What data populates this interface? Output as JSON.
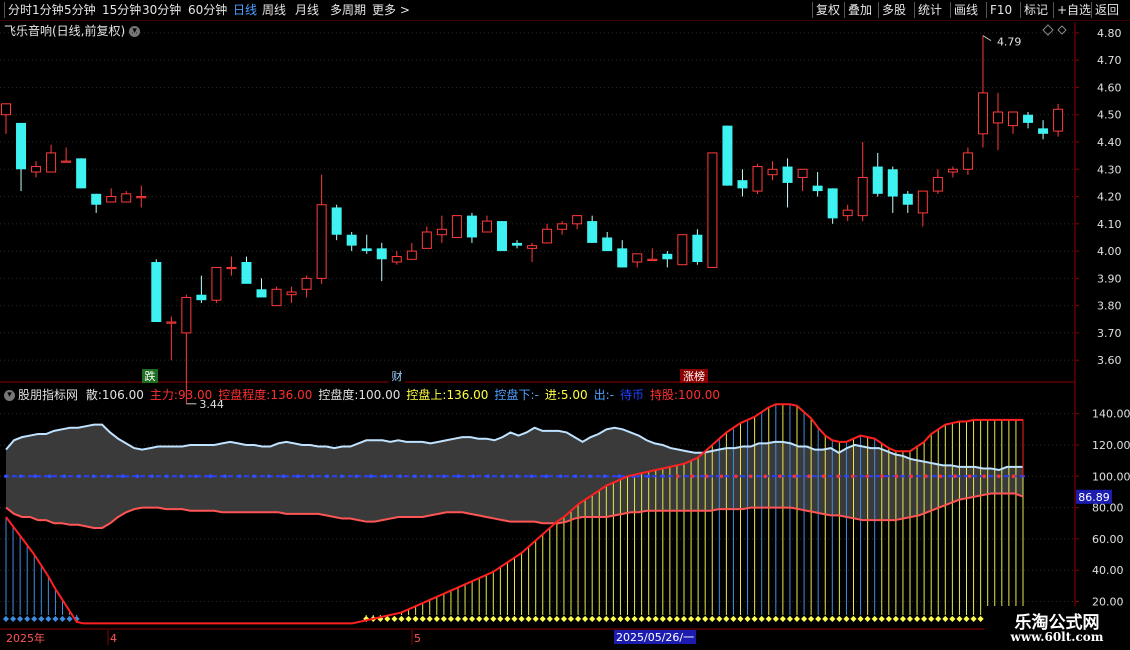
{
  "toolbar": {
    "left": [
      "分时",
      "1分钟",
      "5分钟",
      "15分钟",
      "30分钟",
      "60分钟",
      "日线",
      "周线",
      "月线",
      "多周期",
      "更多 >"
    ],
    "right": [
      "复权",
      "叠加",
      "多股",
      "统计",
      "画线",
      "F10",
      "标记",
      "+自选",
      "返回"
    ],
    "active_color": "#4ea0ff"
  },
  "main_chart": {
    "title": "飞乐音响(日线,前复权)",
    "high_label": "4.79",
    "low_label": "3.44",
    "y_ticks": [
      "4.80",
      "4.70",
      "4.60",
      "4.50",
      "4.40",
      "4.30",
      "4.20",
      "4.10",
      "4.00",
      "3.90",
      "3.80",
      "3.70",
      "3.60"
    ],
    "markers": [
      {
        "text": "跌",
        "bg": "#1f6e1f",
        "fg": "#ffffff"
      },
      {
        "text": "财",
        "bg": "#000000",
        "fg": "#9ad0ff"
      },
      {
        "text": "涨榜",
        "bg": "#8b0000",
        "fg": "#ffffff"
      }
    ]
  },
  "chart_data": {
    "type": "candlestick",
    "y_range": [
      3.52,
      4.84
    ],
    "candles": [
      [
        4.5,
        4.54,
        4.43,
        4.54
      ],
      [
        4.47,
        4.47,
        4.22,
        4.3
      ],
      [
        4.29,
        4.33,
        4.27,
        4.31
      ],
      [
        4.29,
        4.39,
        4.29,
        4.36
      ],
      [
        4.33,
        4.38,
        4.33,
        4.33
      ],
      [
        4.34,
        4.34,
        4.23,
        4.23
      ],
      [
        4.21,
        4.21,
        4.14,
        4.17
      ],
      [
        4.18,
        4.23,
        4.18,
        4.2
      ],
      [
        4.18,
        4.22,
        4.18,
        4.21
      ],
      [
        4.2,
        4.24,
        4.16,
        4.2
      ],
      [
        3.96,
        3.97,
        3.74,
        3.74
      ],
      [
        3.74,
        3.76,
        3.6,
        3.74
      ],
      [
        3.7,
        3.84,
        3.44,
        3.83
      ],
      [
        3.84,
        3.91,
        3.81,
        3.82
      ],
      [
        3.82,
        3.93,
        3.81,
        3.94
      ],
      [
        3.94,
        3.98,
        3.91,
        3.94
      ],
      [
        3.96,
        3.98,
        3.89,
        3.88
      ],
      [
        3.86,
        3.9,
        3.84,
        3.83
      ],
      [
        3.8,
        3.87,
        3.8,
        3.86
      ],
      [
        3.84,
        3.87,
        3.81,
        3.85
      ],
      [
        3.86,
        3.91,
        3.83,
        3.9
      ],
      [
        3.9,
        4.28,
        3.88,
        4.17
      ],
      [
        4.16,
        4.17,
        4.04,
        4.06
      ],
      [
        4.06,
        4.07,
        4.0,
        4.02
      ],
      [
        4.01,
        4.06,
        3.99,
        4.0
      ],
      [
        4.01,
        4.03,
        3.89,
        3.97
      ],
      [
        3.96,
        4.0,
        3.95,
        3.98
      ],
      [
        3.97,
        4.03,
        3.97,
        4.0
      ],
      [
        4.01,
        4.09,
        4.01,
        4.07
      ],
      [
        4.06,
        4.13,
        4.03,
        4.08
      ],
      [
        4.05,
        4.13,
        4.05,
        4.13
      ],
      [
        4.13,
        4.14,
        4.03,
        4.05
      ],
      [
        4.07,
        4.13,
        4.07,
        4.11
      ],
      [
        4.11,
        4.11,
        4.02,
        4.0
      ],
      [
        4.03,
        4.04,
        4.01,
        4.02
      ],
      [
        4.01,
        4.03,
        3.96,
        4.02
      ],
      [
        4.03,
        4.1,
        4.03,
        4.08
      ],
      [
        4.08,
        4.11,
        4.06,
        4.1
      ],
      [
        4.1,
        4.13,
        4.08,
        4.13
      ],
      [
        4.11,
        4.13,
        4.03,
        4.03
      ],
      [
        4.05,
        4.07,
        4.0,
        4.0
      ],
      [
        4.01,
        4.04,
        3.94,
        3.94
      ],
      [
        3.96,
        3.99,
        3.94,
        3.99
      ],
      [
        3.97,
        4.01,
        3.97,
        3.97
      ],
      [
        3.99,
        4.0,
        3.94,
        3.97
      ],
      [
        3.95,
        4.06,
        3.95,
        4.06
      ],
      [
        4.06,
        4.08,
        3.95,
        3.96
      ],
      [
        3.94,
        4.36,
        3.94,
        4.36
      ],
      [
        4.46,
        4.46,
        4.24,
        4.24
      ],
      [
        4.26,
        4.3,
        4.2,
        4.23
      ],
      [
        4.22,
        4.32,
        4.21,
        4.31
      ],
      [
        4.28,
        4.33,
        4.26,
        4.3
      ],
      [
        4.31,
        4.34,
        4.16,
        4.25
      ],
      [
        4.27,
        4.3,
        4.22,
        4.3
      ],
      [
        4.24,
        4.29,
        4.2,
        4.22
      ],
      [
        4.23,
        4.23,
        4.1,
        4.12
      ],
      [
        4.13,
        4.17,
        4.11,
        4.15
      ],
      [
        4.13,
        4.4,
        4.11,
        4.27
      ],
      [
        4.31,
        4.36,
        4.2,
        4.21
      ],
      [
        4.3,
        4.31,
        4.14,
        4.2
      ],
      [
        4.21,
        4.22,
        4.14,
        4.17
      ],
      [
        4.14,
        4.2,
        4.09,
        4.22
      ],
      [
        4.22,
        4.3,
        4.21,
        4.27
      ],
      [
        4.29,
        4.31,
        4.27,
        4.3
      ],
      [
        4.3,
        4.38,
        4.28,
        4.36
      ],
      [
        4.43,
        4.79,
        4.38,
        4.58
      ],
      [
        4.47,
        4.58,
        4.37,
        4.51
      ],
      [
        4.46,
        4.51,
        4.43,
        4.51
      ],
      [
        4.5,
        4.51,
        4.45,
        4.47
      ],
      [
        4.45,
        4.48,
        4.41,
        4.43
      ],
      [
        4.44,
        4.54,
        4.42,
        4.52
      ]
    ]
  },
  "indicator": {
    "name": "股朋指标网",
    "fields": [
      {
        "label": "散:",
        "value": "106.00",
        "color": "#e0e0e0"
      },
      {
        "label": "主力:",
        "value": "93.00",
        "color": "#ff3030"
      },
      {
        "label": "控盘程度:",
        "value": "136.00",
        "color": "#ff3030"
      },
      {
        "label": "控盘度:",
        "value": "100.00",
        "color": "#e0e0e0"
      },
      {
        "label": "控盘上:",
        "value": "136.00",
        "color": "#ffff40"
      },
      {
        "label": "控盘下:",
        "value": "-",
        "color": "#4ea0ff"
      },
      {
        "label": "进:",
        "value": "5.00",
        "color": "#ffff40"
      },
      {
        "label": "出:",
        "value": "-",
        "color": "#4ea0ff"
      },
      {
        "label": "",
        "value": "待币",
        "color": "#2040ff"
      },
      {
        "label": "持股:",
        "value": "100.00",
        "color": "#ff3030"
      }
    ],
    "y_ticks": [
      "140.00",
      "120.00",
      "100.00",
      "80.00",
      "60.00",
      "40.00",
      "20.00"
    ],
    "current_value": "86.89"
  },
  "indicator_data": {
    "y_range": [
      5,
      150
    ],
    "upper": [
      117,
      123,
      125,
      126,
      127,
      127,
      129,
      130,
      131,
      131,
      132,
      133,
      133,
      128,
      124,
      121,
      118,
      117,
      118,
      119,
      119,
      119,
      119,
      120,
      120,
      120,
      120,
      121,
      122,
      121,
      120,
      120,
      119,
      119,
      121,
      122,
      121,
      120,
      120,
      119,
      119,
      118,
      119,
      119,
      121,
      123,
      123,
      123,
      122,
      123,
      122,
      122,
      122,
      121,
      122,
      123,
      124,
      125,
      125,
      124,
      124,
      123,
      125,
      128,
      126,
      128,
      131,
      129,
      129,
      129,
      128,
      125,
      122,
      125,
      127,
      130,
      131,
      130,
      128,
      126,
      123,
      121,
      120,
      118,
      117,
      116,
      115,
      115,
      116,
      117,
      118,
      118,
      119,
      119,
      121,
      121,
      122,
      122,
      121,
      119,
      119,
      117,
      117,
      118,
      115,
      118,
      120,
      119,
      118,
      118,
      116,
      114,
      113,
      111,
      110,
      109,
      108,
      107,
      107,
      106,
      106,
      106,
      105,
      105,
      104,
      106,
      106,
      106
    ],
    "lower": [
      80,
      76,
      74,
      74,
      72,
      72,
      70,
      70,
      69,
      69,
      68,
      67,
      67,
      70,
      74,
      77,
      79,
      80,
      80,
      80,
      79,
      79,
      79,
      78,
      78,
      78,
      78,
      77,
      77,
      77,
      77,
      77,
      77,
      77,
      77,
      76,
      76,
      76,
      76,
      76,
      75,
      74,
      73,
      73,
      72,
      71,
      71,
      72,
      73,
      74,
      74,
      74,
      74,
      75,
      76,
      77,
      77,
      77,
      76,
      75,
      74,
      73,
      72,
      71,
      71,
      71,
      71,
      70,
      70,
      70,
      71,
      73,
      74,
      74,
      74,
      74,
      75,
      76,
      77,
      77,
      78,
      78,
      78,
      78,
      78,
      78,
      78,
      78,
      78,
      79,
      79,
      79,
      79,
      80,
      80,
      80,
      80,
      80,
      80,
      79,
      78,
      77,
      76,
      75,
      75,
      74,
      73,
      72,
      72,
      72,
      72,
      72,
      73,
      74,
      75,
      77,
      79,
      81,
      83,
      85,
      86,
      87,
      88,
      89,
      89,
      89,
      89,
      87
    ],
    "main": [
      74,
      68,
      62,
      56,
      50,
      43,
      36,
      28,
      21,
      14,
      7,
      6,
      6,
      6,
      6,
      6,
      6,
      6,
      6,
      6,
      6,
      6,
      6,
      6,
      6,
      6,
      6,
      6,
      6,
      6,
      6,
      6,
      6,
      6,
      6,
      6,
      6,
      6,
      6,
      6,
      6,
      6,
      6,
      6,
      6,
      6,
      6,
      6,
      6,
      6,
      7,
      8,
      9,
      10,
      11,
      12,
      13,
      15,
      17,
      19,
      21,
      23,
      25,
      27,
      29,
      31,
      33,
      35,
      37,
      39,
      42,
      45,
      48,
      51,
      55,
      59,
      63,
      67,
      71,
      74,
      78,
      82,
      85,
      88,
      91,
      94,
      96,
      98,
      100,
      101,
      102,
      103,
      104,
      105,
      106,
      107,
      108,
      110,
      112,
      116,
      120,
      124,
      128,
      131,
      134,
      136,
      138,
      141,
      144,
      146,
      146,
      146,
      145,
      141,
      137,
      131,
      126,
      123,
      122,
      122,
      124,
      126,
      125,
      124,
      121,
      118,
      116,
      116,
      116,
      119,
      122,
      127,
      130,
      133,
      134,
      135,
      135,
      136,
      136,
      136,
      136,
      136,
      136,
      136,
      136
    ],
    "mid_line": 100,
    "stems_start": 100,
    "stems_yellow_from": 84,
    "stems_blue_until": 10
  },
  "timeline": {
    "labels": [
      "2025年",
      "4",
      "5",
      "2025/05/26/一"
    ],
    "highlight_color": "#1c1cb0"
  },
  "watermark": {
    "line1": "乐淘公式网",
    "line2": "www.60lt.com"
  }
}
